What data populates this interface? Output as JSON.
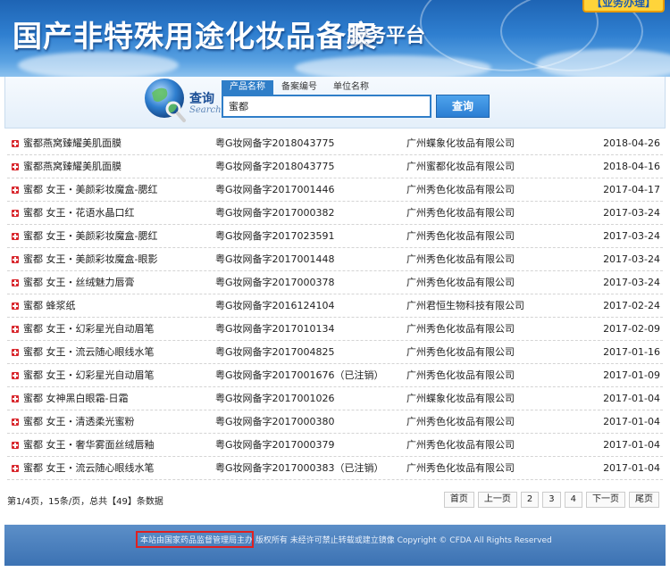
{
  "header": {
    "title": "国产非特殊用途化妆品备案",
    "subtitle": "服务平台",
    "badge": "【业务办理】"
  },
  "search": {
    "label": "查询",
    "label_en": "Search",
    "tabs": [
      {
        "label": "产品名称",
        "active": true
      },
      {
        "label": "备案编号",
        "active": false
      },
      {
        "label": "单位名称",
        "active": false
      }
    ],
    "value": "蜜都",
    "button_label": "查询"
  },
  "results": [
    {
      "name": "蜜都燕窝臻耀美肌面膜",
      "record_no": "粤G妆网备字2018043775",
      "company": "广州蝶象化妆品有限公司",
      "date": "2018-04-26"
    },
    {
      "name": "蜜都燕窝臻耀美肌面膜",
      "record_no": "粤G妆网备字2018043775",
      "company": "广州蜜都化妆品有限公司",
      "date": "2018-04-16"
    },
    {
      "name": "蜜都 女王・美颜彩妆魔盒-腮红",
      "record_no": "粤G妆网备字2017001446",
      "company": "广州秀色化妆品有限公司",
      "date": "2017-04-17"
    },
    {
      "name": "蜜都 女王・花语水晶口红",
      "record_no": "粤G妆网备字2017000382",
      "company": "广州秀色化妆品有限公司",
      "date": "2017-03-24"
    },
    {
      "name": "蜜都 女王・美颜彩妆魔盒-腮红",
      "record_no": "粤G妆网备字2017023591",
      "company": "广州秀色化妆品有限公司",
      "date": "2017-03-24"
    },
    {
      "name": "蜜都 女王・美颜彩妆魔盒-眼影",
      "record_no": "粤G妆网备字2017001448",
      "company": "广州秀色化妆品有限公司",
      "date": "2017-03-24"
    },
    {
      "name": "蜜都 女王・丝绒魅力唇膏",
      "record_no": "粤G妆网备字2017000378",
      "company": "广州秀色化妆品有限公司",
      "date": "2017-03-24"
    },
    {
      "name": "蜜都 蜂浆纸",
      "record_no": "粤G妆网备字2016124104",
      "company": "广州君恒生物科技有限公司",
      "date": "2017-02-24"
    },
    {
      "name": "蜜都 女王・幻彩星光自动眉笔",
      "record_no": "粤G妆网备字2017010134",
      "company": "广州秀色化妆品有限公司",
      "date": "2017-02-09"
    },
    {
      "name": "蜜都 女王・流云随心眼线水笔",
      "record_no": "粤G妆网备字2017004825",
      "company": "广州秀色化妆品有限公司",
      "date": "2017-01-16"
    },
    {
      "name": "蜜都 女王・幻彩星光自动眉笔",
      "record_no": "粤G妆网备字2017001676（已注销）",
      "company": "广州秀色化妆品有限公司",
      "date": "2017-01-09"
    },
    {
      "name": "蜜都 女神黑白眼霜-日霜",
      "record_no": "粤G妆网备字2017001026",
      "company": "广州蝶象化妆品有限公司",
      "date": "2017-01-04"
    },
    {
      "name": "蜜都 女王・清透柔光蜜粉",
      "record_no": "粤G妆网备字2017000380",
      "company": "广州秀色化妆品有限公司",
      "date": "2017-01-04"
    },
    {
      "name": "蜜都 女王・奢华雾面丝绒唇釉",
      "record_no": "粤G妆网备字2017000379",
      "company": "广州秀色化妆品有限公司",
      "date": "2017-01-04"
    },
    {
      "name": "蜜都 女王・流云随心眼线水笔",
      "record_no": "粤G妆网备字2017000383（已注销）",
      "company": "广州秀色化妆品有限公司",
      "date": "2017-01-04"
    }
  ],
  "pagination": {
    "info": "第1/4页，15条/页，总共【49】条数据",
    "buttons": [
      "首页",
      "上一页",
      "2",
      "3",
      "4",
      "下一页",
      "尾页"
    ]
  },
  "footer": {
    "text": "本站由国家药品监督管理局主办 版权所有 未经许可禁止转载或建立镜像 Copyright © CFDA All Rights Reserved"
  },
  "colors": {
    "header_blue": "#2f7fd0",
    "tab_active": "#2f7ec8",
    "bullet_red": "#d8262c",
    "highlight_red": "#e02020"
  }
}
